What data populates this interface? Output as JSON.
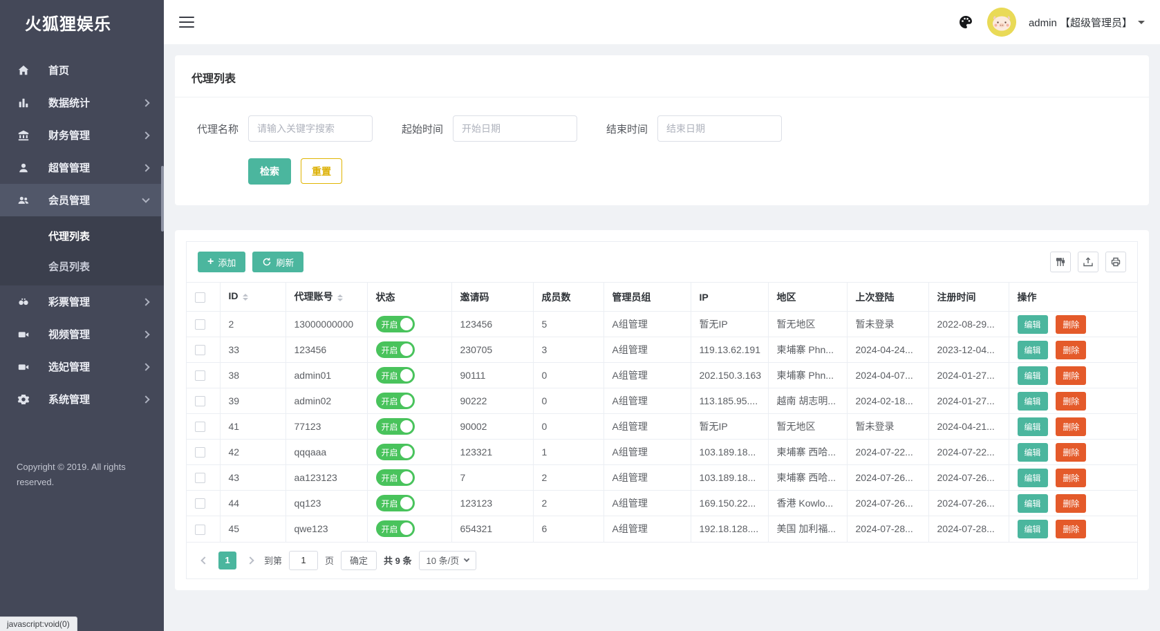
{
  "app": {
    "logo_text": "火狐狸娱乐",
    "status_bar": "javascript:void(0)"
  },
  "colors": {
    "teal_accent": "#4bb69e",
    "toggle_green": "#49c35c",
    "delete_orange": "#e45a2a",
    "reset_gold": "#e0b400",
    "sidebar_bg": "#444858"
  },
  "sidebar": {
    "menu": [
      {
        "label": "首页",
        "icon": "home-icon",
        "has_children": false
      },
      {
        "label": "数据统计",
        "icon": "bar-chart-icon",
        "has_children": true
      },
      {
        "label": "财务管理",
        "icon": "bank-icon",
        "has_children": true
      },
      {
        "label": "超管管理",
        "icon": "user-icon",
        "has_children": true
      },
      {
        "label": "会员管理",
        "icon": "users-icon",
        "has_children": true,
        "expanded": true,
        "active": true
      },
      {
        "label": "彩票管理",
        "icon": "lottery-icon",
        "has_children": true
      },
      {
        "label": "视频管理",
        "icon": "video-icon",
        "has_children": true
      },
      {
        "label": "选妃管理",
        "icon": "video-icon",
        "has_children": true
      },
      {
        "label": "系统管理",
        "icon": "gear-icon",
        "has_children": true
      }
    ],
    "submenu": [
      {
        "label": "代理列表",
        "current": true
      },
      {
        "label": "会员列表",
        "current": false
      }
    ],
    "copyright": "Copyright © 2019. All rights reserved."
  },
  "header": {
    "username": "admin 【超级管理员】",
    "icons": [
      "palette-icon",
      "avatar"
    ]
  },
  "filter": {
    "title": "代理列表",
    "name_label": "代理名称",
    "name_placeholder": "请输入关键字搜索",
    "start_label": "起始时间",
    "start_placeholder": "开始日期",
    "end_label": "结束时间",
    "end_placeholder": "结束日期",
    "search_label": "检索",
    "reset_label": "重置"
  },
  "table": {
    "add_label": "添加",
    "refresh_label": "刷新",
    "toolbar_icons": [
      "columns-filter-icon",
      "export-icon",
      "print-icon"
    ],
    "headers": [
      "ID",
      "代理账号",
      "状态",
      "邀请码",
      "成员数",
      "管理员组",
      "IP",
      "地区",
      "上次登陆",
      "注册时间",
      "操作"
    ],
    "edit_label": "编辑",
    "delete_label": "删除",
    "rows": [
      {
        "id": "2",
        "account": "13000000000",
        "status": "开启",
        "invite_code": "123456",
        "members": "5",
        "admin_group": "A组管理",
        "ip": "暂无IP",
        "region": "暂无地区",
        "last_login": "暂未登录",
        "register_time": "2022-08-29..."
      },
      {
        "id": "33",
        "account": "123456",
        "status": "开启",
        "invite_code": "230705",
        "members": "3",
        "admin_group": "A组管理",
        "ip": "119.13.62.191",
        "region": "柬埔寨 Phn...",
        "last_login": "2024-04-24...",
        "register_time": "2023-12-04..."
      },
      {
        "id": "38",
        "account": "admin01",
        "status": "开启",
        "invite_code": "90111",
        "members": "0",
        "admin_group": "A组管理",
        "ip": "202.150.3.163",
        "region": "柬埔寨 Phn...",
        "last_login": "2024-04-07...",
        "register_time": "2024-01-27..."
      },
      {
        "id": "39",
        "account": "admin02",
        "status": "开启",
        "invite_code": "90222",
        "members": "0",
        "admin_group": "A组管理",
        "ip": "113.185.95....",
        "region": "越南 胡志明...",
        "last_login": "2024-02-18...",
        "register_time": "2024-01-27..."
      },
      {
        "id": "41",
        "account": "77123",
        "status": "开启",
        "invite_code": "90002",
        "members": "0",
        "admin_group": "A组管理",
        "ip": "暂无IP",
        "region": "暂无地区",
        "last_login": "暂未登录",
        "register_time": "2024-04-21..."
      },
      {
        "id": "42",
        "account": "qqqaaa",
        "status": "开启",
        "invite_code": "123321",
        "members": "1",
        "admin_group": "A组管理",
        "ip": "103.189.18...",
        "region": "柬埔寨 西哈...",
        "last_login": "2024-07-22...",
        "register_time": "2024-07-22..."
      },
      {
        "id": "43",
        "account": "aa123123",
        "status": "开启",
        "invite_code": "7",
        "members": "2",
        "admin_group": "A组管理",
        "ip": "103.189.18...",
        "region": "柬埔寨 西哈...",
        "last_login": "2024-07-26...",
        "register_time": "2024-07-26..."
      },
      {
        "id": "44",
        "account": "qq123",
        "status": "开启",
        "invite_code": "123123",
        "members": "2",
        "admin_group": "A组管理",
        "ip": "169.150.22...",
        "region": "香港 Kowlo...",
        "last_login": "2024-07-26...",
        "register_time": "2024-07-26..."
      },
      {
        "id": "45",
        "account": "qwe123",
        "status": "开启",
        "invite_code": "654321",
        "members": "6",
        "admin_group": "A组管理",
        "ip": "192.18.128....",
        "region": "美国 加利福...",
        "last_login": "2024-07-28...",
        "register_time": "2024-07-28..."
      }
    ]
  },
  "pagination": {
    "current_page": "1",
    "goto_prefix": "到第",
    "goto_value": "1",
    "goto_suffix": "页",
    "confirm_label": "确定",
    "total_label": "共 9 条",
    "page_size_label": "10 条/页"
  }
}
